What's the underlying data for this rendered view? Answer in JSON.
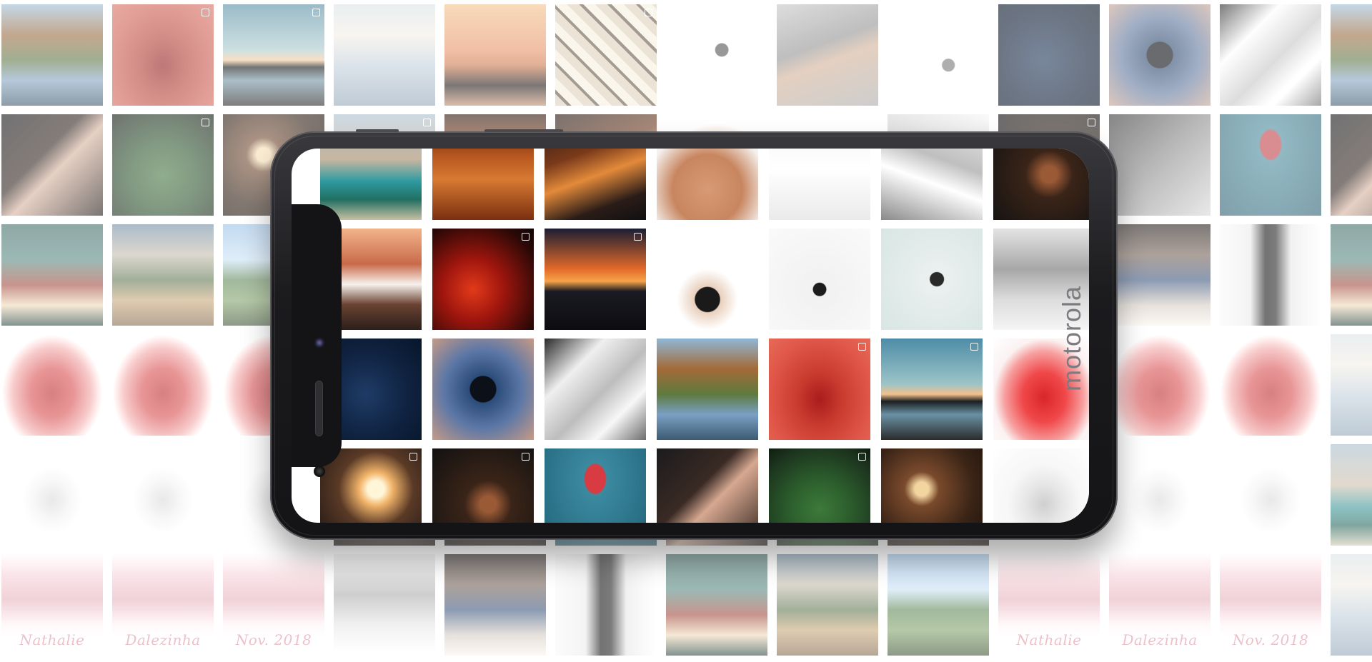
{
  "brand": {
    "logo_text": "motorola"
  },
  "captions": [
    "Nathalie",
    "Dalezinha",
    "Nov. 2018"
  ],
  "background_tiles": [
    [
      "forest-lake",
      "red-dress-duo",
      "sunset-lake-man",
      "arch-city",
      "sunset-beach-man",
      "mirror-hall",
      "skater-white",
      "skater-floor",
      "skater-white-2",
      "blue-ear",
      "rose-silhouette",
      "white-fabric",
      "forest-lake"
    ],
    [
      "portrait-dark",
      "monstera-leaves",
      "cafe-lights",
      "resort-pool",
      "desert-footprints",
      "city-night",
      "shirtless-man",
      "skate-bowl",
      "skate-bowl-2",
      "dark-portrait-2",
      "hand-portrait",
      "red-top-teal",
      "portrait-dark"
    ],
    [
      "green-door-woman",
      "market-stall",
      "cactus-garden",
      "rooftop-man",
      "red-car",
      "ocean-sunset",
      "boy-tshirt",
      "sitting-man",
      "skater-jump",
      "white-dress-statue",
      "woman-couch",
      "black-suit",
      "green-door-woman"
    ],
    [
      "red-gown",
      "red-gown",
      "red-gown",
      "blue-ear",
      "rose-silhouette",
      "white-fabric",
      "forest-lake",
      "red-dress-duo",
      "sunset-lake-man",
      "red-gown",
      "red-gown",
      "red-gown",
      "arch-city"
    ],
    [
      "white-outfit",
      "white-outfit",
      "white-outfit",
      "sunburst",
      "dark-portrait-2",
      "red-top-teal",
      "portrait-dark",
      "monstera-leaves",
      "cafe-lights",
      "white-outfit",
      "white-outfit",
      "white-outfit",
      "resort-pool"
    ],
    [
      "polaroid-pink",
      "polaroid-pink",
      "polaroid-pink",
      "white-dress-statue",
      "woman-couch",
      "black-suit",
      "green-door-woman",
      "market-stall",
      "cactus-garden",
      "polaroid-pink",
      "polaroid-pink",
      "polaroid-pink",
      "arch-city"
    ]
  ],
  "screen_tiles": [
    [
      "resort-pool",
      "desert-footprints",
      "city-night",
      "shirtless-man",
      "skate-bowl",
      "skate-bowl-2",
      "dark-portrait-2"
    ],
    [
      "rooftop-man",
      "red-car",
      "ocean-sunset",
      "boy-tshirt",
      "sitting-man",
      "skater-jump",
      "white-dress-statue"
    ],
    [
      "blue-ear",
      "rose-silhouette",
      "white-fabric",
      "forest-lake",
      "red-dress-duo",
      "sunset-lake-man",
      "red-gown"
    ],
    [
      "sunburst",
      "dark-portrait-2",
      "red-top-teal",
      "portrait-dark",
      "monstera-leaves",
      "cafe-lights",
      "white-outfit"
    ]
  ],
  "palette": {
    "forest-lake": "linear-gradient(180deg,#8fb7d6 0%,#a36a38 30%,#5e7a3e 55%,#7aa0c4 75%,#3c5b72 100%)",
    "red-dress-duo": "radial-gradient(ellipse at 50% 60%,#a81c1c 0%,#c83a2e 30%,#e0574a 70%,#e66a58 100%)",
    "sunset-lake-man": "linear-gradient(180deg,#4d8ca8 0%,#9cc4c8 45%,#f3c08a 55%,#1a1f20 62%,#6a91a5 75%,#2b2b2b 100%)",
    "arch-city": "linear-gradient(180deg,#cfd8dc 0%,#e7e2d8 30%,#b9c8d6 60%,#8aa3b8 100%)",
    "sunset-beach-man": "linear-gradient(180deg,#f4b777 0%,#f08c5a 45%,#d8743e 60%,#2a2220 80%,#c88a62 100%)",
    "mirror-hall": "repeating-linear-gradient(45deg,#d9c6ad 0 12px,#6b5a48 12px 16px,#efe3d0 16px 28px)",
    "skater-white": "radial-gradient(circle at 55% 45%,#555 0 8%,#f2f2f2 9%,#ffffff 100%)",
    "skater-floor": "linear-gradient(160deg,#bdbdbd 0%,#8f8f8f 40%,#d0a88a 55%,#a6a6a6 100%)",
    "skater-white-2": "radial-gradient(circle at 60% 60%,#777 0 7%,#f6f6f6 8%,#ffffff 100%)",
    "blue-ear": "radial-gradient(circle at 45% 55%,#1f3b66 0%,#0f2240 55%,#07162a 100%)",
    "rose-silhouette": "radial-gradient(circle at 50% 50%,#0c1018 0 18%,#2b4c7a 19%,#5d78a6 55%,#c79a86 100%)",
    "white-fabric": "linear-gradient(135deg,#2a2a2a 0%,#efefef 30%,#bdbdbd 55%,#f7f7f7 75%,#6d6d6d 100%)",
    "portrait-dark": "linear-gradient(135deg,#1b1b1d 0%,#3a2a24 40%,#d6a890 55%,#2a1f1a 100%)",
    "monstera-leaves": "radial-gradient(circle at 50% 60%,#3d7a3a 0%,#2b5c2c 40%,#1c331d 80%,#0f1c10 100%)",
    "cafe-lights": "radial-gradient(circle at 40% 40%,#f3d5a0 0 8%,#7a4a2c 20%,#3a2416 60%,#1d120c 100%)",
    "resort-pool": "linear-gradient(180deg,#9db7c9 0%,#c9b7a0 40%,#2e9aa0 62%,#216f62 80%,#c9c0a4 100%)",
    "desert-footprints": "linear-gradient(180deg,#3a1a0e 0%,#b4541e 35%,#d77a32 60%,#7a2f10 100%)",
    "city-night": "linear-gradient(160deg,#2b1a12 0%,#7a3a1a 35%,#e38a3a 55%,#2a1c18 80%,#101010 100%)",
    "shirtless-man": "radial-gradient(circle at 50% 70%,#d79a74 0%,#c88660 40%,#f4f1ee 70%,#ffffff 100%)",
    "skate-bowl": "linear-gradient(180deg,#f4f4f4 0%,#ffffff 50%,#eaeaea 100%)",
    "skate-bowl-2": "linear-gradient(200deg,#e9e9e9 0%,#bfbfbf 40%,#ffffff 60%,#8a8a8a 100%)",
    "dark-portrait-2": "radial-gradient(circle at 55% 55%,#9a5a36 0 10%,#3a2418 30%,#111 100%)",
    "hand-portrait": "linear-gradient(135deg,#3a3a3a 0%,#8a8a8a 50%,#cfcfcf 100%)",
    "red-top-teal": "radial-gradient(ellipse at 50% 30%,#d83b42 0 14%,#3b8aa0 16%,#22637a 100%)",
    "green-door-woman": "linear-gradient(180deg,#3e6f6a 0%,#4f8a82 35%,#b34a3a 60%,#e8cfa8 80%,#2e4e4a 100%)",
    "market-stall": "linear-gradient(180deg,#6a8ca6 0%,#bfb5a4 30%,#5f7a4e 55%,#c9a26a 75%,#8a6a4a 100%)",
    "cactus-garden": "linear-gradient(180deg,#8dbbe6 0%,#bcd8ef 35%,#5d8a52 55%,#7aa25e 75%,#405a34 100%)",
    "rooftop-man": "linear-gradient(180deg,#f2b48a 0%,#c96a4a 35%,#f7f2ec 55%,#6a4232 75%,#2b1f1a 100%)",
    "red-car": "radial-gradient(circle at 40% 60%,#e23a1a 0%,#a0160e 35%,#2a0806 80%,#100404 100%)",
    "ocean-sunset": "linear-gradient(180deg,#1b1e33 0%,#e36a2a 40%,#f7a34a 52%,#1a1a22 62%,#0c0c10 100%)",
    "boy-tshirt": "radial-gradient(circle at 50% 70%,#1a1a1a 0 14%,#e9d0bd 15%,#ffffff 35%,#ffffff 100%)",
    "sitting-man": "radial-gradient(circle at 50% 60%,#1c1c1c 0 8%,#f1f1f1 9%,#fafafa 100%)",
    "skater-jump": "radial-gradient(circle at 55% 50%,#2a2a2a 0 9%,#eaf0ef 10%,#d8e6e3 100%)",
    "white-dress-statue": "linear-gradient(180deg,#e4e4e4 0%,#a7a7a7 40%,#dcdcdc 70%,#f5f5f5 100%)",
    "woman-couch": "linear-gradient(180deg,#2e2622 0%,#7a6254 30%,#3c5a8a 55%,#cfc4b8 80%,#efe8e0 100%)",
    "black-suit": "linear-gradient(90deg,#ececec 0%,#e0e0e0 30%,#1c1c1c 45%,#2a2a2a 55%,#dcdcdc 70%,#f2f2f2 100%)",
    "red-gown": "radial-gradient(ellipse at 50% 58%,#d9262a 0%,#f0484a 30%,#f7a0a0 55%,#fbf2f2 70%,#ffffff 100%)",
    "white-outfit": "radial-gradient(ellipse at 50% 55%,#cfcfcf 0%,#e6e6e6 25%,#f7f7f7 50%,#ffffff 100%)",
    "polaroid-pink": "linear-gradient(180deg,#fbeef2 0%,#f1c7d0 20%,#e7a9b6 45%,#f6e7ea 70%,#ffffff 100%)",
    "sunburst": "radial-gradient(circle at 55% 40%,#fff6d8 0 10%,#f2b46a 20%,#5a3a26 45%,#141010 100%)"
  },
  "badged": [
    "red-dress-duo",
    "mirror-hall",
    "skater-white-2",
    "resort-pool",
    "skate-bowl",
    "dark-portrait-2",
    "red-car",
    "ocean-sunset",
    "sunset-lake-man",
    "sunburst",
    "monstera-leaves",
    "white-outfit"
  ],
  "captioned": {
    "polaroid-pink": true
  }
}
